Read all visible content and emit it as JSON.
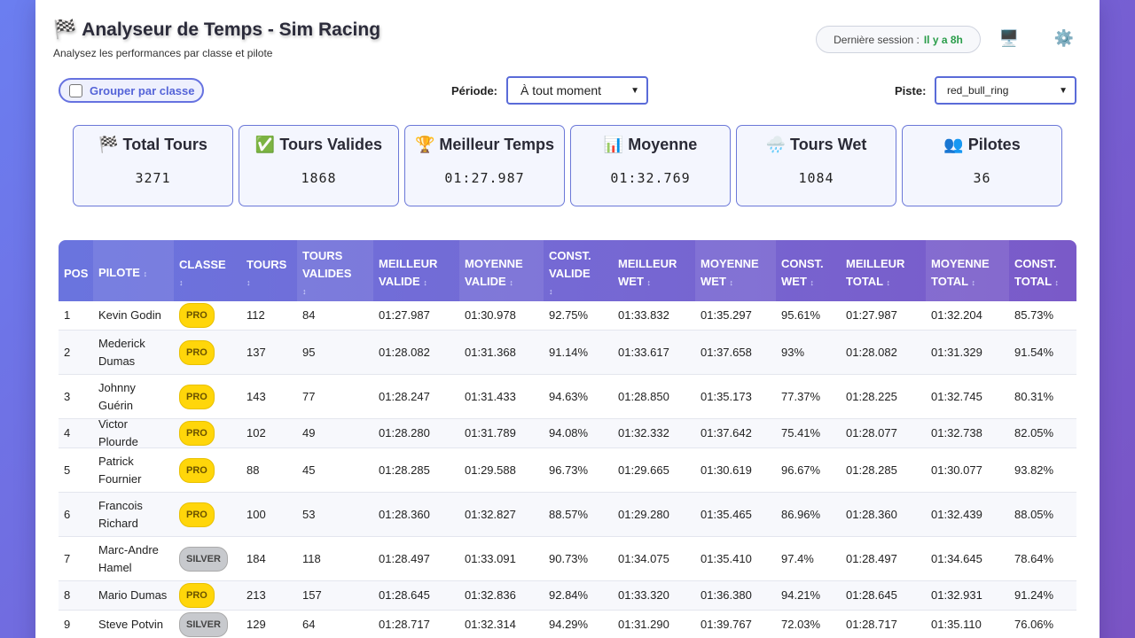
{
  "header": {
    "title": "Analyseur de Temps - Sim Racing",
    "flag_icon": "🏁",
    "subtitle": "Analysez les performances par classe et pilote",
    "session_label": "Dernière session :",
    "session_value": "Il y a 8h",
    "monitor_icon": "🖥️",
    "settings_icon": "⚙️"
  },
  "controls": {
    "group_label": "Grouper par classe",
    "period_label": "Période:",
    "period_value": "À tout moment",
    "track_label": "Piste:",
    "track_value": "red_bull_ring"
  },
  "stats": [
    {
      "icon": "🏁",
      "label": "Total Tours",
      "value": "3271"
    },
    {
      "icon": "✅",
      "label": "Tours Valides",
      "value": "1868"
    },
    {
      "icon": "🏆",
      "label": "Meilleur Temps",
      "value": "01:27.987"
    },
    {
      "icon": "📊",
      "label": "Moyenne",
      "value": "01:32.769"
    },
    {
      "icon": "🌧️",
      "label": "Tours Wet",
      "value": "1084"
    },
    {
      "icon": "👥",
      "label": "Pilotes",
      "value": "36"
    }
  ],
  "table": {
    "headers": [
      {
        "line1": "POS",
        "line2": "",
        "sort": false
      },
      {
        "line1": "PILOTE",
        "line2": "",
        "sort": true,
        "inline": true
      },
      {
        "line1": "CLASSE",
        "line2": "",
        "sort": true
      },
      {
        "line1": "TOURS",
        "line2": "",
        "sort": true
      },
      {
        "line1": "TOURS",
        "line2": "VALIDES",
        "sort": true
      },
      {
        "line1": "MEILLEUR",
        "line2": "VALIDE",
        "sort": true,
        "inline": true
      },
      {
        "line1": "MOYENNE",
        "line2": "VALIDE",
        "sort": true,
        "inline": true
      },
      {
        "line1": "CONST.",
        "line2": "VALIDE",
        "sort": true
      },
      {
        "line1": "MEILLEUR",
        "line2": "WET",
        "sort": true,
        "inline": true
      },
      {
        "line1": "MOYENNE",
        "line2": "WET",
        "sort": true,
        "inline": true
      },
      {
        "line1": "CONST.",
        "line2": "WET",
        "sort": true,
        "inline": true
      },
      {
        "line1": "MEILLEUR",
        "line2": "TOTAL",
        "sort": true,
        "inline": true
      },
      {
        "line1": "MOYENNE",
        "line2": "TOTAL",
        "sort": true,
        "inline": true
      },
      {
        "line1": "CONST.",
        "line2": "TOTAL",
        "sort": true,
        "inline": true
      }
    ],
    "sort_glyph": "↕",
    "rows": [
      {
        "pos": "1",
        "pilote": [
          "Kevin Godin"
        ],
        "classe": "PRO",
        "tours": "112",
        "valides": "84",
        "mv": "01:27.987",
        "moyv": "01:30.978",
        "cv": "92.75%",
        "mw": "01:33.832",
        "moyw": "01:35.297",
        "cw": "95.61%",
        "mt": "01:27.987",
        "moyt": "01:32.204",
        "ct": "85.73%"
      },
      {
        "pos": "2",
        "pilote": [
          "Mederick",
          "Dumas"
        ],
        "classe": "PRO",
        "tours": "137",
        "valides": "95",
        "mv": "01:28.082",
        "moyv": "01:31.368",
        "cv": "91.14%",
        "mw": "01:33.617",
        "moyw": "01:37.658",
        "cw": "93%",
        "mt": "01:28.082",
        "moyt": "01:31.329",
        "ct": "91.54%"
      },
      {
        "pos": "3",
        "pilote": [
          "Johnny",
          "Guérin"
        ],
        "classe": "PRO",
        "tours": "143",
        "valides": "77",
        "mv": "01:28.247",
        "moyv": "01:31.433",
        "cv": "94.63%",
        "mw": "01:28.850",
        "moyw": "01:35.173",
        "cw": "77.37%",
        "mt": "01:28.225",
        "moyt": "01:32.745",
        "ct": "80.31%"
      },
      {
        "pos": "4",
        "pilote": [
          "Victor Plourde"
        ],
        "classe": "PRO",
        "tours": "102",
        "valides": "49",
        "mv": "01:28.280",
        "moyv": "01:31.789",
        "cv": "94.08%",
        "mw": "01:32.332",
        "moyw": "01:37.642",
        "cw": "75.41%",
        "mt": "01:28.077",
        "moyt": "01:32.738",
        "ct": "82.05%"
      },
      {
        "pos": "5",
        "pilote": [
          "Patrick",
          "Fournier"
        ],
        "classe": "PRO",
        "tours": "88",
        "valides": "45",
        "mv": "01:28.285",
        "moyv": "01:29.588",
        "cv": "96.73%",
        "mw": "01:29.665",
        "moyw": "01:30.619",
        "cw": "96.67%",
        "mt": "01:28.285",
        "moyt": "01:30.077",
        "ct": "93.82%"
      },
      {
        "pos": "6",
        "pilote": [
          "Francois",
          "Richard"
        ],
        "classe": "PRO",
        "tours": "100",
        "valides": "53",
        "mv": "01:28.360",
        "moyv": "01:32.827",
        "cv": "88.57%",
        "mw": "01:29.280",
        "moyw": "01:35.465",
        "cw": "86.96%",
        "mt": "01:28.360",
        "moyt": "01:32.439",
        "ct": "88.05%"
      },
      {
        "pos": "7",
        "pilote": [
          "Marc-Andre",
          "Hamel"
        ],
        "classe": "SILVER",
        "tours": "184",
        "valides": "118",
        "mv": "01:28.497",
        "moyv": "01:33.091",
        "cv": "90.73%",
        "mw": "01:34.075",
        "moyw": "01:35.410",
        "cw": "97.4%",
        "mt": "01:28.497",
        "moyt": "01:34.645",
        "ct": "78.64%"
      },
      {
        "pos": "8",
        "pilote": [
          "Mario Dumas"
        ],
        "classe": "PRO",
        "tours": "213",
        "valides": "157",
        "mv": "01:28.645",
        "moyv": "01:32.836",
        "cv": "92.84%",
        "mw": "01:33.320",
        "moyw": "01:36.380",
        "cw": "94.21%",
        "mt": "01:28.645",
        "moyt": "01:32.931",
        "ct": "91.24%"
      },
      {
        "pos": "9",
        "pilote": [
          "Steve Potvin"
        ],
        "classe": "SILVER",
        "tours": "129",
        "valides": "64",
        "mv": "01:28.717",
        "moyv": "01:32.314",
        "cv": "94.29%",
        "mw": "01:31.290",
        "moyw": "01:39.767",
        "cw": "72.03%",
        "mt": "01:28.717",
        "moyt": "01:35.110",
        "ct": "76.06%"
      }
    ]
  }
}
